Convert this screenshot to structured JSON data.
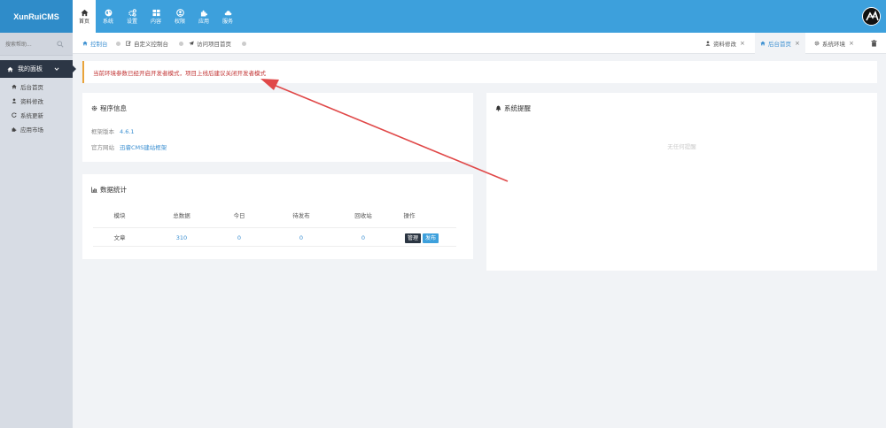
{
  "app": {
    "logo_text": "XunRuiCMS"
  },
  "nav": [
    {
      "label": "首页",
      "icon": "home-icon"
    },
    {
      "label": "系统",
      "icon": "globe-icon"
    },
    {
      "label": "设置",
      "icon": "gears-icon"
    },
    {
      "label": "内容",
      "icon": "grid-icon"
    },
    {
      "label": "权限",
      "icon": "user-circle-icon"
    },
    {
      "label": "应用",
      "icon": "puzzle-icon"
    },
    {
      "label": "服务",
      "icon": "cloud-icon"
    }
  ],
  "sidebar": {
    "search_placeholder": "搜索帮助...",
    "menu_title": "我的面板",
    "items": [
      {
        "label": "后台首页",
        "icon": "home-icon"
      },
      {
        "label": "资料修改",
        "icon": "user-icon"
      },
      {
        "label": "系统更新",
        "icon": "refresh-icon"
      },
      {
        "label": "应用市场",
        "icon": "puzzle-icon"
      }
    ]
  },
  "breadcrumb": [
    {
      "label": "控制台",
      "icon": "home-icon"
    },
    {
      "label": "自定义控制台",
      "icon": "edit-icon"
    },
    {
      "label": "访问项目首页",
      "icon": "send-icon"
    }
  ],
  "tabs": [
    {
      "label": "资料修改",
      "icon": "user-icon",
      "close": "×"
    },
    {
      "label": "后台首页",
      "icon": "home-icon",
      "close": "×"
    },
    {
      "label": "系统环境",
      "icon": "gear-icon",
      "close": "×"
    }
  ],
  "alert": {
    "text": "当前环境参数已经开启开发者模式，项目上线后建议关闭开发者模式"
  },
  "program_info": {
    "title": "程序信息",
    "version_label": "框架版本",
    "version_value": "4.6.1",
    "site_label": "官方网站",
    "site_value": "迅睿CMS建站框架"
  },
  "stats": {
    "title": "数据统计",
    "headers": [
      "模块",
      "总数据",
      "今日",
      "待发布",
      "回收站",
      "操作"
    ],
    "row": {
      "module": "文章",
      "total": "310",
      "today": "0",
      "pending": "0",
      "recycle": "0"
    },
    "manage_label": "管理",
    "publish_label": "发布"
  },
  "reminder": {
    "title": "系统提醒",
    "empty_text": "无任何提醒"
  },
  "colors": {
    "topbar": "#3da0dc",
    "accent": "#3b8fd1",
    "alert_text": "#c23434",
    "annotation_arrow": "#e04848"
  }
}
